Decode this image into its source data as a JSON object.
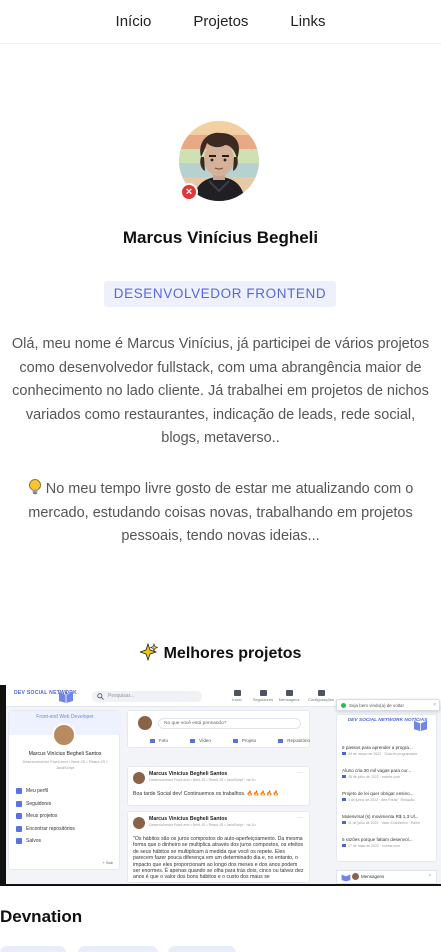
{
  "nav": {
    "items": [
      "Início",
      "Projetos",
      "Links"
    ]
  },
  "profile": {
    "name": "Marcus Vinícius Begheli",
    "role": "DESENVOLVEDOR FRONTEND",
    "bio": "Olá, meu nome é Marcus Vinícius, já participei de vários projetos como desenvolvedor fullstack, com uma abrangência maior de conhecimento no lado cliente. Já trabalhei em projetos de nichos variados como restaurantes, indicação de leads, rede social, blogs, metaverso..",
    "bio2": "No meu tempo livre gosto de estar me atualizando com o mercado, estudando coisas novas, trabalhando em projetos pessoais, tendo novas ideias...",
    "status_color": "#e0363b"
  },
  "projects": {
    "title": "Melhores projetos",
    "featured": {
      "name": "Devnation",
      "screenshot": {
        "brand": "DEV SOCIAL NETWORK",
        "search_placeholder": "Pesquisar...",
        "nav": [
          "Início",
          "Seguidores",
          "Mensagens",
          "Configurações"
        ],
        "profile_card": {
          "banner": "Front-end Web Developer",
          "name": "Marcus Vinícius Begheli Santos",
          "subtitle": "Desenvolvedor Front-end • Next.JS • React.JS • JavaScript",
          "menu": [
            "Meu perfil",
            "Seguidores",
            "Meus projetos",
            "Encontrar repositórios",
            "Salvos"
          ],
          "footer": "+ Sair"
        },
        "composer": {
          "placeholder": "No que você está pensando?",
          "actions": [
            "Foto",
            "Vídeo",
            "Projeto",
            "Repositório"
          ]
        },
        "posts": [
          {
            "author": "Marcus Vinícius Begheli Santos",
            "meta": "Desenvolvedor Front-end • Next.JS • React.JS • JavaScript · há 1h",
            "text": "Boa tarde Social dev! Continuemos os trabalhos. 🔥🔥🔥🔥🔥"
          },
          {
            "author": "Marcus Vinícius Begheli Santos",
            "meta": "Desenvolvedor Front-end • Next.JS • React.JS • JavaScript · há 1h",
            "text": "\"Os hábitos são os juros compostos do auto-aperfeiçoamento. Da mesma forma que o dinheiro se multiplica através dos juros compostos, os efeitos de seus hábitos se multiplicam à medida que você os repete. Eles parecem fazer pouca diferença em um determinado dia e, no entanto, o impacto que eles proporcionam ao longo dos meses e dos anos podem ser enormes. É apenas quando se olha para trás dois, cinco ou talvez dez anos é que o valor dos bons hábitos e o custo dos maus se"
          }
        ],
        "toast": "Seja bem vindo(a) de volta!",
        "news": {
          "title": "DEV SOCIAL NETWORK NOTÍCIAS",
          "items": [
            {
              "title": "5 passos para aprender a progra...",
              "meta": "24 de março de 2022 · Guia do programador"
            },
            {
              "title": "Aluno cria 30 mil vagas para cur...",
              "meta": "28 de julho de 2022 · exame.com"
            },
            {
              "title": "Projeto de lei quer obrigar ensino...",
              "meta": "1 de junho de 2022 · Arte Portal · Redação"
            },
            {
              "title": "Mulesvrsal (s) movimenta R$ 1,3 Ul...",
              "meta": "11 de julho de 2022 · Valor Econômico · Editor"
            },
            {
              "title": "5 razões porque faltam desenvol...",
              "meta": "17 de maio de 2022 · exame.com"
            }
          ]
        },
        "message_bar": "Mensagens"
      }
    }
  }
}
